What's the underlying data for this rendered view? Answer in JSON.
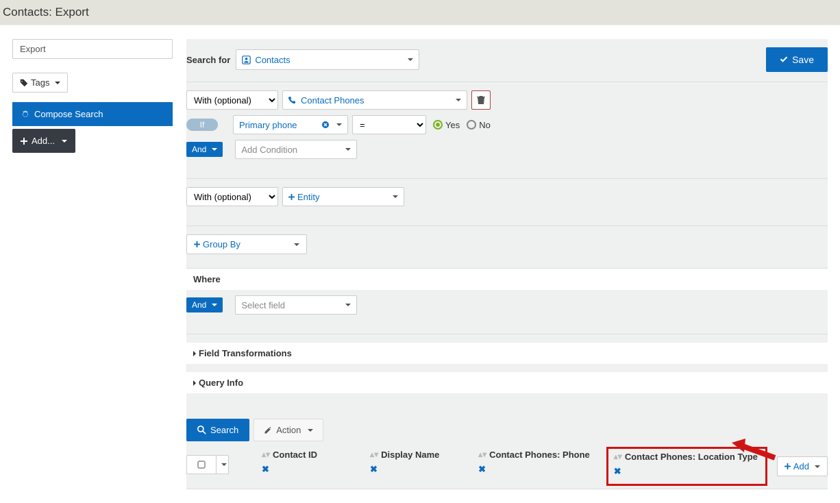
{
  "page_title": "Contacts: Export",
  "sidebar": {
    "export_label": "Export",
    "tags_label": "Tags",
    "compose_label": "Compose Search",
    "add_label": "Add..."
  },
  "toolbar": {
    "search_for_label": "Search for",
    "search_entity": "Contacts",
    "save_label": "Save"
  },
  "with_block1": {
    "with_label": "With (optional)",
    "entity": "Contact Phones",
    "if_label": "If",
    "field": "Primary phone",
    "operator": "=",
    "yes_label": "Yes",
    "no_label": "No",
    "and_label": "And",
    "add_condition_placeholder": "Add Condition"
  },
  "with_block2": {
    "with_label": "With (optional)",
    "entity_placeholder": "Entity"
  },
  "group_by_label": "Group By",
  "where": {
    "heading": "Where",
    "and_label": "And",
    "select_field_placeholder": "Select field"
  },
  "accordions": {
    "field_transformations": "Field Transformations",
    "query_info": "Query Info"
  },
  "actions": {
    "search_label": "Search",
    "action_label": "Action"
  },
  "columns": [
    {
      "label": "Contact ID"
    },
    {
      "label": "Display Name"
    },
    {
      "label": "Contact Phones: Phone"
    },
    {
      "label": "Contact Phones: Location Type"
    }
  ],
  "add_column_label": "Add",
  "colors": {
    "primary": "#0b6cbf",
    "dark": "#363b44",
    "annotate": "#d01414"
  }
}
